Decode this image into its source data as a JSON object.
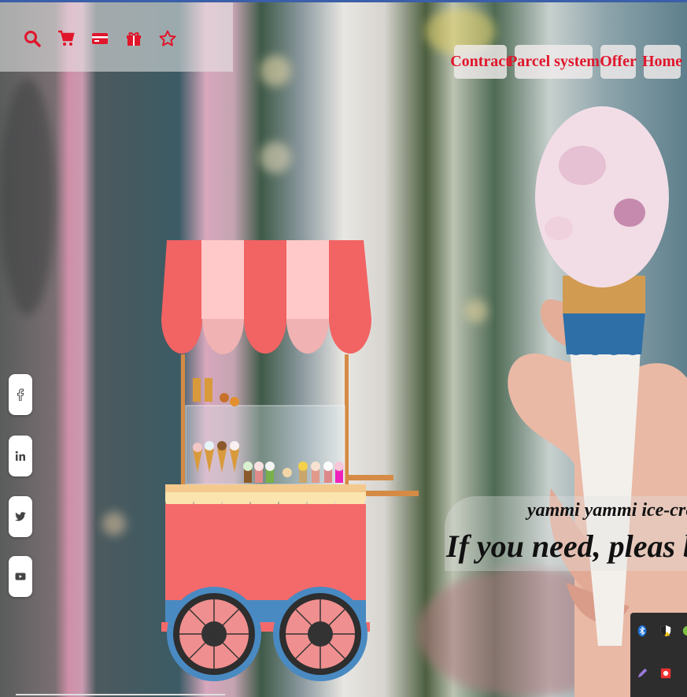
{
  "top_icons": [
    {
      "name": "search-icon"
    },
    {
      "name": "cart-icon"
    },
    {
      "name": "credit-card-icon"
    },
    {
      "name": "gift-icon"
    },
    {
      "name": "star-icon"
    }
  ],
  "nav": {
    "items": [
      "Contract",
      "Parcel system",
      "Offer",
      "Home"
    ]
  },
  "social": [
    "facebook-icon",
    "linkedin-icon",
    "twitter-icon",
    "youtube-icon"
  ],
  "hero": {
    "tagline_small": "yammi yammi ice-cream",
    "tagline_large": "If you need, pleas bye and t"
  },
  "colors": {
    "accent_red": "#e0162b",
    "awning_red": "#f26363",
    "awning_pink": "#ffc9c9",
    "cart_body": "#f46a6a",
    "wheel_blue": "#4a8ac2"
  }
}
